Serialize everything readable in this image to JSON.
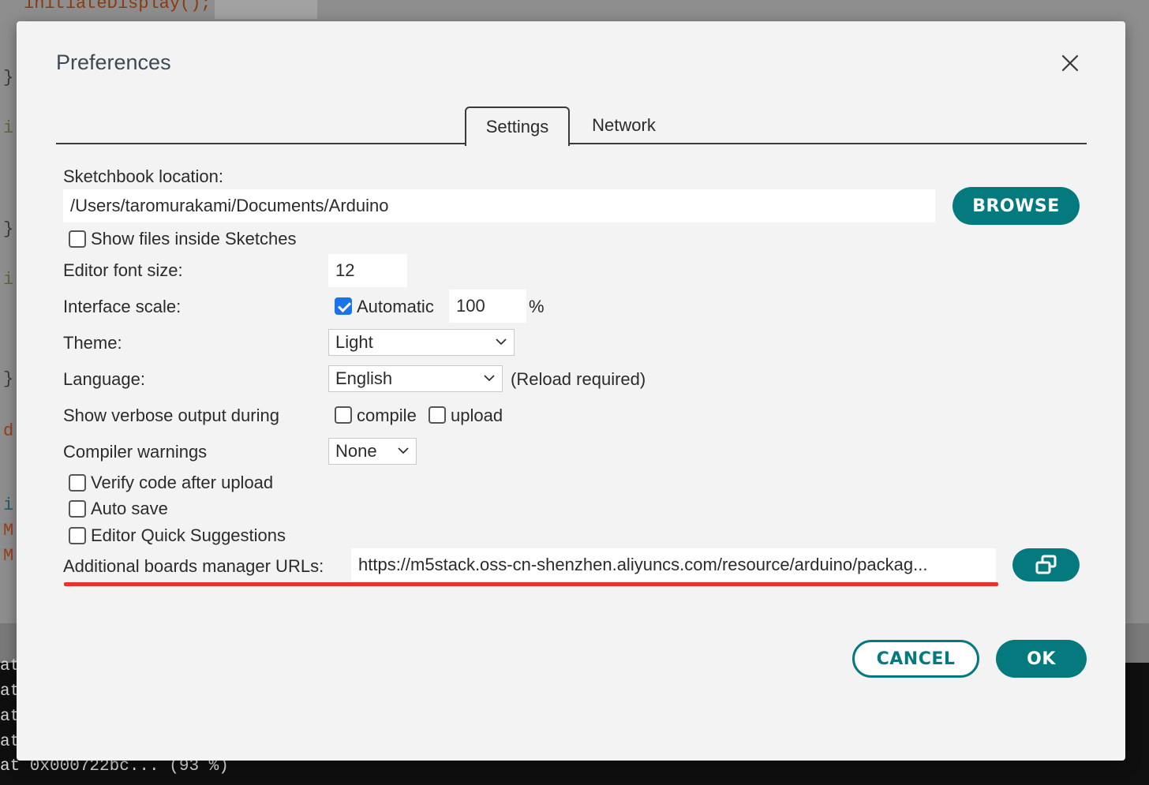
{
  "background": {
    "code_top": "initiateDisplay();",
    "gutter": [
      {
        "char": "}",
        "cls": ""
      },
      {
        "char": "i",
        "cls": "green"
      },
      {
        "char": "}",
        "cls": ""
      },
      {
        "char": "i",
        "cls": "green"
      },
      {
        "char": "}",
        "cls": ""
      },
      {
        "char": "d",
        "cls": "red"
      },
      {
        "char": "i",
        "cls": "teal"
      },
      {
        "char": "M",
        "cls": "red"
      },
      {
        "char": "M",
        "cls": "red"
      }
    ],
    "console_lines": [
      "at",
      "at",
      "at",
      "at",
      "at 0x000722bc... (93 %)"
    ]
  },
  "dialog": {
    "title": "Preferences",
    "tabs": [
      {
        "label": "Settings",
        "active": true
      },
      {
        "label": "Network",
        "active": false
      }
    ],
    "sketchbook": {
      "label": "Sketchbook location:",
      "value": "/Users/taromurakami/Documents/Arduino",
      "browse_label": "BROWSE"
    },
    "show_files": {
      "label": "Show files inside Sketches",
      "checked": false
    },
    "font_size": {
      "label": "Editor font size:",
      "value": "12"
    },
    "interface_scale": {
      "label": "Interface scale:",
      "automatic_label": "Automatic",
      "automatic_checked": true,
      "value": "100",
      "unit": "%"
    },
    "theme": {
      "label": "Theme:",
      "value": "Light"
    },
    "language": {
      "label": "Language:",
      "value": "English",
      "note": "(Reload required)"
    },
    "verbose": {
      "label": "Show verbose output during",
      "compile_label": "compile",
      "compile_checked": false,
      "upload_label": "upload",
      "upload_checked": false
    },
    "compiler_warnings": {
      "label": "Compiler warnings",
      "value": "None"
    },
    "verify": {
      "label": "Verify code after upload",
      "checked": false
    },
    "autosave": {
      "label": "Auto save",
      "checked": false
    },
    "quick_suggestions": {
      "label": "Editor Quick Suggestions",
      "checked": false
    },
    "boards_urls": {
      "label": "Additional boards manager URLs:",
      "value": "https://m5stack.oss-cn-shenzhen.aliyuncs.com/resource/arduino/packag..."
    },
    "cancel_label": "CANCEL",
    "ok_label": "OK"
  },
  "colors": {
    "accent": "#047a7e",
    "highlight": "#e8322e",
    "checkbox_checked": "#1a73e8"
  },
  "icons": [
    "close-icon",
    "open-window-icon",
    "chevron-down-icon",
    "checkmark-icon"
  ]
}
